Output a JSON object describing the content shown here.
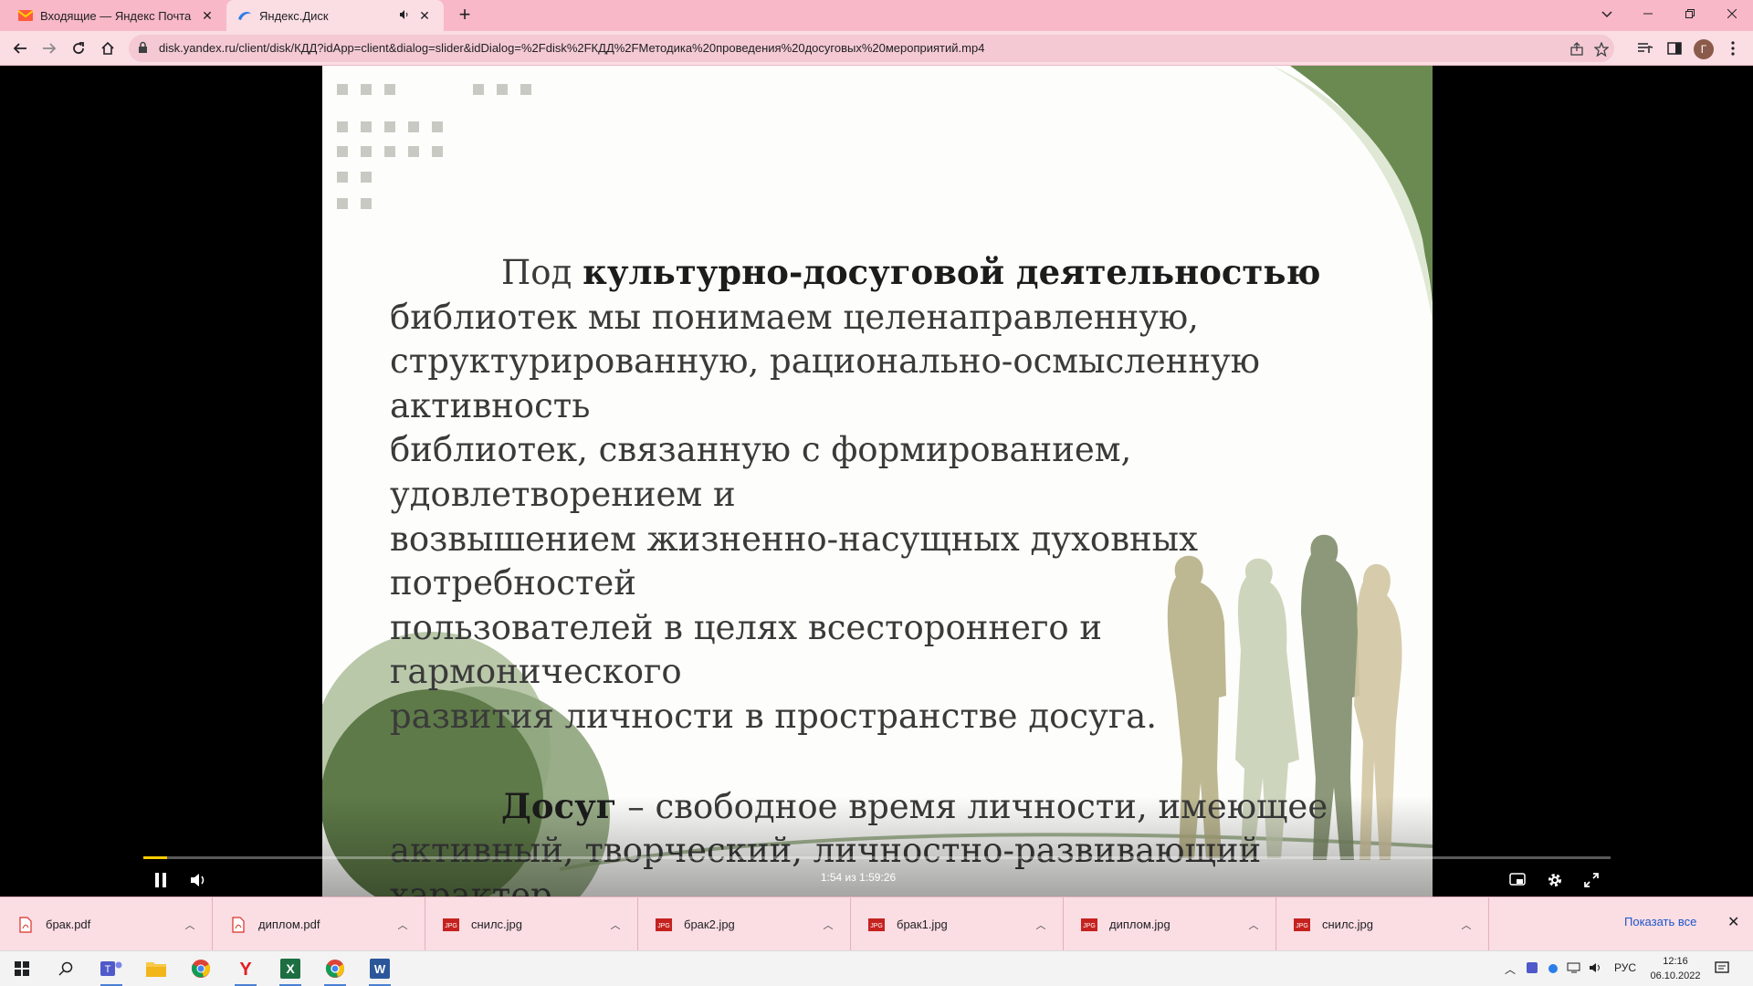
{
  "browser": {
    "tabs": [
      {
        "title": "Входящие — Яндекс Почта",
        "icon": "yandex-mail-icon",
        "active": false
      },
      {
        "title": "Яндекс.Диск",
        "icon": "yandex-disk-icon",
        "active": true,
        "audio": true
      }
    ],
    "url": "disk.yandex.ru/client/disk/КДД?idApp=client&dialog=slider&idDialog=%2Fdisk%2FКДД%2FМетодика%20проведения%20досуговых%20мероприятий.mp4",
    "profile_initial": "Г"
  },
  "slide": {
    "p1_lead": "Под ",
    "p1_bold": "культурно-досуговой деятельностью",
    "p1_lines": [
      "библиотек мы понимаем целенаправленную,",
      "структурированную, рационально-осмысленную активность",
      "библиотек, связанную с формированием, удовлетворением и",
      "возвышением жизненно-насущных духовных потребностей",
      "пользователей в целях всестороннего и гармонического",
      "развития личности в пространстве досуга."
    ],
    "p2_bold": "Досуг",
    "p2_rest": " – свободное время личности, имеющее",
    "p2_line2": "активный, творческий, личностно-развивающий характер."
  },
  "player": {
    "timecode": "1:54 из 1:59:26",
    "progress_fraction": 0.016,
    "state": "playing"
  },
  "downloads": {
    "items": [
      {
        "name": "брак.pdf",
        "type": "pdf"
      },
      {
        "name": "диплом.pdf",
        "type": "pdf"
      },
      {
        "name": "снилс.jpg",
        "type": "jpg"
      },
      {
        "name": "брак2.jpg",
        "type": "jpg"
      },
      {
        "name": "брак1.jpg",
        "type": "jpg"
      },
      {
        "name": "диплом.jpg",
        "type": "jpg"
      },
      {
        "name": "снилс.jpg",
        "type": "jpg"
      }
    ],
    "show_all": "Показать все"
  },
  "taskbar": {
    "lang": "РУС",
    "time": "12:16",
    "date": "06.10.2022"
  },
  "colors": {
    "tab_strip": "#f8b8c7",
    "toolbar": "#fbdde4",
    "progress": "#ffcc00",
    "slide_green": "#6b8a52"
  }
}
